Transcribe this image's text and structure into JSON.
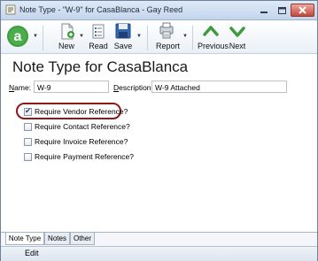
{
  "window": {
    "title": "Note Type - \"W-9\" for CasaBlanca - Gay Reed"
  },
  "toolbar": {
    "new_label": "New",
    "read_label": "Read",
    "save_label": "Save",
    "report_label": "Report",
    "previous_label": "Previous",
    "next_label": "Next"
  },
  "page": {
    "heading": "Note Type for CasaBlanca"
  },
  "form": {
    "name_label_underlined": "N",
    "name_label_rest": "ame:",
    "name_value": "W-9",
    "description_label_underlined": "D",
    "description_label_rest": "escription:",
    "description_value": "W-9 Attached"
  },
  "checkboxes": [
    {
      "label": "Require Vendor Reference?",
      "checked": true
    },
    {
      "label": "Require Contact Reference?",
      "checked": false
    },
    {
      "label": "Require Invoice Reference?",
      "checked": false
    },
    {
      "label": "Require Payment Reference?",
      "checked": false
    }
  ],
  "tabs": [
    "Note Type",
    "Notes",
    "Other"
  ],
  "status": {
    "mode": "Edit"
  },
  "colors": {
    "brand_green": "#3d9a3d",
    "highlight_ring": "#8b1a1a"
  },
  "icons": {
    "app": "app-logo-icon",
    "new": "new-document-icon",
    "read": "read-list-icon",
    "save": "save-disk-icon",
    "report": "report-icon",
    "previous": "up-chevron-icon",
    "next": "down-chevron-icon"
  }
}
